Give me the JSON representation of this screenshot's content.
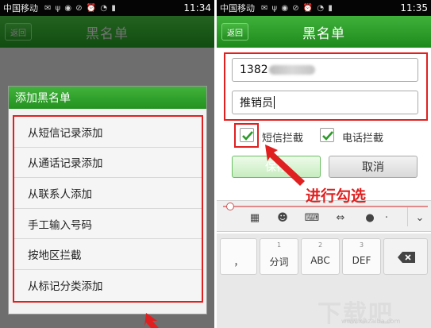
{
  "left_screen": {
    "status": {
      "carrier": "中国移动",
      "icons": "✉ ψ ◉  ⊘ ⏰ ◔ ▮",
      "time": "11:34"
    },
    "back_label": "返回",
    "title": "黑名单",
    "dialog": {
      "title": "添加黑名单",
      "items": [
        "从短信记录添加",
        "从通话记录添加",
        "从联系人添加",
        "手工输入号码",
        "按地区拦截",
        "从标记分类添加"
      ]
    }
  },
  "right_screen": {
    "status": {
      "carrier": "中国移动",
      "icons": "✉ ψ ◉  ⊘ ⏰ ◔ ▮",
      "time": "11:35"
    },
    "back_label": "返回",
    "title": "黑名单",
    "phone_prefix": "1382",
    "phone_suffix_redacted": true,
    "name_value": "推销员",
    "sms_block": {
      "label": "短信拦截",
      "checked": true
    },
    "call_block": {
      "label": "电话拦截",
      "checked": true
    },
    "save_label": "保存",
    "cancel_label": "取消",
    "annotation": "进行勾选",
    "keyboard": {
      "keys": [
        {
          "num": "",
          "label": "，"
        },
        {
          "num": "1",
          "label": "分词"
        },
        {
          "num": "2",
          "label": "ABC"
        },
        {
          "num": "3",
          "label": "DEF"
        }
      ]
    }
  },
  "watermark": "下载吧",
  "watermark_url": "www.xiazaiba.com",
  "colors": {
    "green": "#2a9a26",
    "red": "#e02020"
  }
}
